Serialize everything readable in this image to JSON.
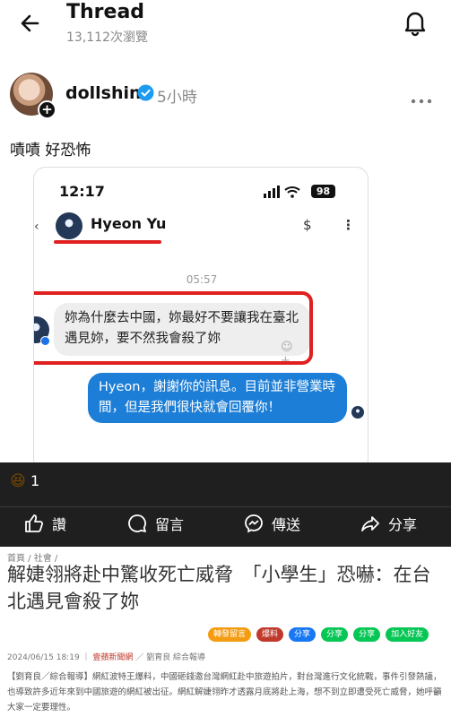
{
  "header": {
    "title": "Thread",
    "views": "13,112次瀏覽"
  },
  "post": {
    "username": "dollshin",
    "time": "5小時",
    "text": "嘖嘖 好恐怖"
  },
  "screenshot": {
    "status_time": "12:17",
    "battery": "98",
    "chat_back": "‹",
    "chat_name": "Hyeon Yu",
    "dollar": "$",
    "kebab": "⋮",
    "chat_time": "05:57",
    "incoming_message": "妳為什麼去中國，妳最好不要讓我在臺北遇見妳，要不然我會殺了妳",
    "react_icon": "☺+",
    "outgoing_message": "Hyeon，謝謝你的訊息。目前並非營業時間，但是我們很快就會回覆你！"
  },
  "reactions": {
    "emoji": "😆",
    "count": "1"
  },
  "actions": {
    "like": "讚",
    "comment": "留言",
    "share": "傳送",
    "forward": "分享"
  },
  "news": {
    "breadcrumb": "首頁 / 社會 /",
    "title": "解婕翎將赴中驚收死亡威脅　「小學生」恐嚇：在台北遇見會殺了妳",
    "share_buttons": [
      {
        "label": "轉發留言",
        "color": "#f39c12"
      },
      {
        "label": "爆料",
        "color": "#c0392b"
      },
      {
        "label": "分享",
        "color": "#1877f2"
      },
      {
        "label": "分享",
        "color": "#06c755"
      },
      {
        "label": "分享",
        "color": "#06c755"
      },
      {
        "label": "加入好友",
        "color": "#06c755"
      }
    ],
    "meta_date": "2024/06/15 18:19",
    "meta_source": "壹蘋新聞網",
    "meta_author": "劉育良 綜合報導",
    "body": "【劉育良／綜合報導】網紅波特王爆料，中國砸錢邀台灣網紅赴中旅遊拍片，對台灣進行文化統戰，事件引發熱議，也導致許多近年來到中國旅遊的網紅被出征。網紅解婕翎昨才透露月底將赴上海，想不到立即遭受死亡威脅，她呼籲大家一定要理性。"
  },
  "colors": {
    "threat_highlight": "#e02020",
    "outgoing_bubble": "#1c7ed6",
    "dark_bar": "#1f1f1f"
  },
  "icons": [
    "back-arrow-icon",
    "bell-icon",
    "verified-icon",
    "more-icon",
    "signal-icon",
    "wifi-icon",
    "thumbs-up-icon",
    "comment-icon",
    "messenger-icon",
    "share-arrow-icon"
  ]
}
